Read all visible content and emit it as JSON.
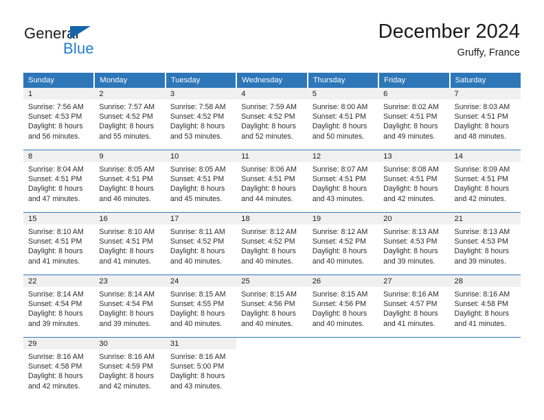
{
  "brand": {
    "name_top": "General",
    "name_bottom": "Blue",
    "triangle_color": "#1565ac",
    "blue_text_color": "#1f7fd0"
  },
  "header": {
    "title": "December 2024",
    "subtitle": "Gruffy, France"
  },
  "theme": {
    "header_bg": "#2d76b8",
    "header_text": "#ffffff",
    "daynum_band_bg": "#f0f0f0",
    "row_divider": "#2d76b8",
    "body_text": "#2b2b2b",
    "page_bg": "#ffffff"
  },
  "weekdays": [
    "Sunday",
    "Monday",
    "Tuesday",
    "Wednesday",
    "Thursday",
    "Friday",
    "Saturday"
  ],
  "weeks": [
    [
      {
        "day": "1",
        "lines": [
          "Sunrise: 7:56 AM",
          "Sunset: 4:53 PM",
          "Daylight: 8 hours",
          "and 56 minutes."
        ]
      },
      {
        "day": "2",
        "lines": [
          "Sunrise: 7:57 AM",
          "Sunset: 4:52 PM",
          "Daylight: 8 hours",
          "and 55 minutes."
        ]
      },
      {
        "day": "3",
        "lines": [
          "Sunrise: 7:58 AM",
          "Sunset: 4:52 PM",
          "Daylight: 8 hours",
          "and 53 minutes."
        ]
      },
      {
        "day": "4",
        "lines": [
          "Sunrise: 7:59 AM",
          "Sunset: 4:52 PM",
          "Daylight: 8 hours",
          "and 52 minutes."
        ]
      },
      {
        "day": "5",
        "lines": [
          "Sunrise: 8:00 AM",
          "Sunset: 4:51 PM",
          "Daylight: 8 hours",
          "and 50 minutes."
        ]
      },
      {
        "day": "6",
        "lines": [
          "Sunrise: 8:02 AM",
          "Sunset: 4:51 PM",
          "Daylight: 8 hours",
          "and 49 minutes."
        ]
      },
      {
        "day": "7",
        "lines": [
          "Sunrise: 8:03 AM",
          "Sunset: 4:51 PM",
          "Daylight: 8 hours",
          "and 48 minutes."
        ]
      }
    ],
    [
      {
        "day": "8",
        "lines": [
          "Sunrise: 8:04 AM",
          "Sunset: 4:51 PM",
          "Daylight: 8 hours",
          "and 47 minutes."
        ]
      },
      {
        "day": "9",
        "lines": [
          "Sunrise: 8:05 AM",
          "Sunset: 4:51 PM",
          "Daylight: 8 hours",
          "and 46 minutes."
        ]
      },
      {
        "day": "10",
        "lines": [
          "Sunrise: 8:05 AM",
          "Sunset: 4:51 PM",
          "Daylight: 8 hours",
          "and 45 minutes."
        ]
      },
      {
        "day": "11",
        "lines": [
          "Sunrise: 8:06 AM",
          "Sunset: 4:51 PM",
          "Daylight: 8 hours",
          "and 44 minutes."
        ]
      },
      {
        "day": "12",
        "lines": [
          "Sunrise: 8:07 AM",
          "Sunset: 4:51 PM",
          "Daylight: 8 hours",
          "and 43 minutes."
        ]
      },
      {
        "day": "13",
        "lines": [
          "Sunrise: 8:08 AM",
          "Sunset: 4:51 PM",
          "Daylight: 8 hours",
          "and 42 minutes."
        ]
      },
      {
        "day": "14",
        "lines": [
          "Sunrise: 8:09 AM",
          "Sunset: 4:51 PM",
          "Daylight: 8 hours",
          "and 42 minutes."
        ]
      }
    ],
    [
      {
        "day": "15",
        "lines": [
          "Sunrise: 8:10 AM",
          "Sunset: 4:51 PM",
          "Daylight: 8 hours",
          "and 41 minutes."
        ]
      },
      {
        "day": "16",
        "lines": [
          "Sunrise: 8:10 AM",
          "Sunset: 4:51 PM",
          "Daylight: 8 hours",
          "and 41 minutes."
        ]
      },
      {
        "day": "17",
        "lines": [
          "Sunrise: 8:11 AM",
          "Sunset: 4:52 PM",
          "Daylight: 8 hours",
          "and 40 minutes."
        ]
      },
      {
        "day": "18",
        "lines": [
          "Sunrise: 8:12 AM",
          "Sunset: 4:52 PM",
          "Daylight: 8 hours",
          "and 40 minutes."
        ]
      },
      {
        "day": "19",
        "lines": [
          "Sunrise: 8:12 AM",
          "Sunset: 4:52 PM",
          "Daylight: 8 hours",
          "and 40 minutes."
        ]
      },
      {
        "day": "20",
        "lines": [
          "Sunrise: 8:13 AM",
          "Sunset: 4:53 PM",
          "Daylight: 8 hours",
          "and 39 minutes."
        ]
      },
      {
        "day": "21",
        "lines": [
          "Sunrise: 8:13 AM",
          "Sunset: 4:53 PM",
          "Daylight: 8 hours",
          "and 39 minutes."
        ]
      }
    ],
    [
      {
        "day": "22",
        "lines": [
          "Sunrise: 8:14 AM",
          "Sunset: 4:54 PM",
          "Daylight: 8 hours",
          "and 39 minutes."
        ]
      },
      {
        "day": "23",
        "lines": [
          "Sunrise: 8:14 AM",
          "Sunset: 4:54 PM",
          "Daylight: 8 hours",
          "and 39 minutes."
        ]
      },
      {
        "day": "24",
        "lines": [
          "Sunrise: 8:15 AM",
          "Sunset: 4:55 PM",
          "Daylight: 8 hours",
          "and 40 minutes."
        ]
      },
      {
        "day": "25",
        "lines": [
          "Sunrise: 8:15 AM",
          "Sunset: 4:56 PM",
          "Daylight: 8 hours",
          "and 40 minutes."
        ]
      },
      {
        "day": "26",
        "lines": [
          "Sunrise: 8:15 AM",
          "Sunset: 4:56 PM",
          "Daylight: 8 hours",
          "and 40 minutes."
        ]
      },
      {
        "day": "27",
        "lines": [
          "Sunrise: 8:16 AM",
          "Sunset: 4:57 PM",
          "Daylight: 8 hours",
          "and 41 minutes."
        ]
      },
      {
        "day": "28",
        "lines": [
          "Sunrise: 8:16 AM",
          "Sunset: 4:58 PM",
          "Daylight: 8 hours",
          "and 41 minutes."
        ]
      }
    ],
    [
      {
        "day": "29",
        "lines": [
          "Sunrise: 8:16 AM",
          "Sunset: 4:58 PM",
          "Daylight: 8 hours",
          "and 42 minutes."
        ]
      },
      {
        "day": "30",
        "lines": [
          "Sunrise: 8:16 AM",
          "Sunset: 4:59 PM",
          "Daylight: 8 hours",
          "and 42 minutes."
        ]
      },
      {
        "day": "31",
        "lines": [
          "Sunrise: 8:16 AM",
          "Sunset: 5:00 PM",
          "Daylight: 8 hours",
          "and 43 minutes."
        ]
      },
      {
        "day": "",
        "lines": []
      },
      {
        "day": "",
        "lines": []
      },
      {
        "day": "",
        "lines": []
      },
      {
        "day": "",
        "lines": []
      }
    ]
  ]
}
